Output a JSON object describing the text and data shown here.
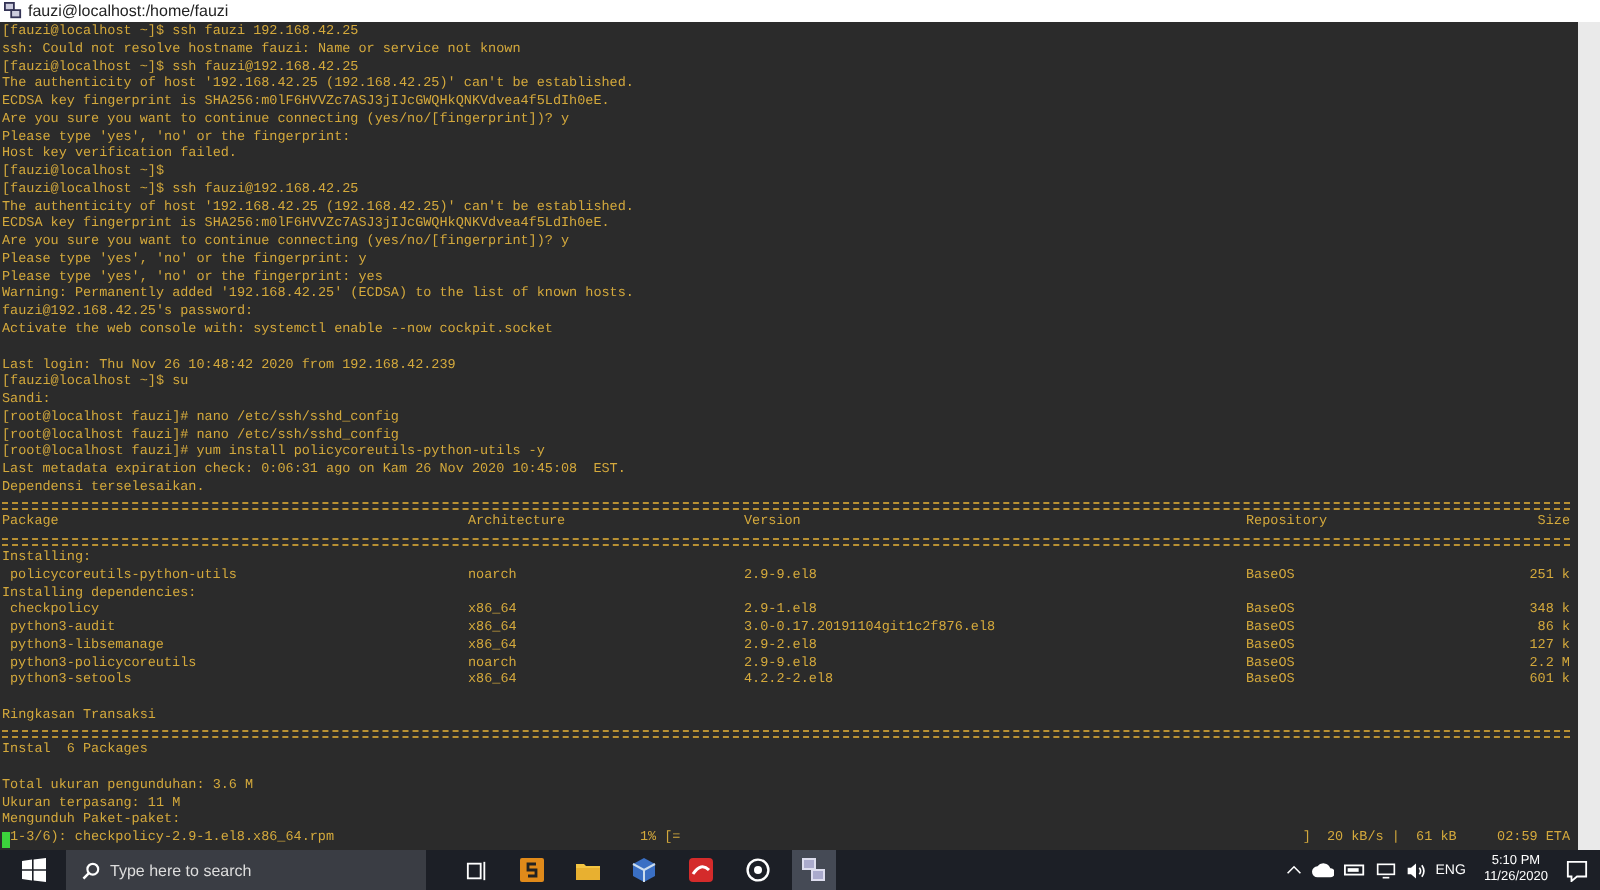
{
  "window": {
    "title": "fauzi@localhost:/home/fauzi"
  },
  "terminal": {
    "lines": [
      {
        "kind": "text",
        "text": "[fauzi@localhost ~]$ ssh fauzi 192.168.42.25"
      },
      {
        "kind": "text",
        "text": "ssh: Could not resolve hostname fauzi: Name or service not known"
      },
      {
        "kind": "text",
        "text": "[fauzi@localhost ~]$ ssh fauzi@192.168.42.25"
      },
      {
        "kind": "text",
        "text": "The authenticity of host '192.168.42.25 (192.168.42.25)' can't be established."
      },
      {
        "kind": "text",
        "text": "ECDSA key fingerprint is SHA256:m0lF6HVVZc7ASJ3jIJcGWQHkQNKVdvea4f5LdIh0eE."
      },
      {
        "kind": "text",
        "text": "Are you sure you want to continue connecting (yes/no/[fingerprint])? y"
      },
      {
        "kind": "text",
        "text": "Please type 'yes', 'no' or the fingerprint:"
      },
      {
        "kind": "text",
        "text": "Host key verification failed."
      },
      {
        "kind": "text",
        "text": "[fauzi@localhost ~]$"
      },
      {
        "kind": "text",
        "text": "[fauzi@localhost ~]$ ssh fauzi@192.168.42.25"
      },
      {
        "kind": "text",
        "text": "The authenticity of host '192.168.42.25 (192.168.42.25)' can't be established."
      },
      {
        "kind": "text",
        "text": "ECDSA key fingerprint is SHA256:m0lF6HVVZc7ASJ3jIJcGWQHkQNKVdvea4f5LdIh0eE."
      },
      {
        "kind": "text",
        "text": "Are you sure you want to continue connecting (yes/no/[fingerprint])? y"
      },
      {
        "kind": "text",
        "text": "Please type 'yes', 'no' or the fingerprint: y"
      },
      {
        "kind": "text",
        "text": "Please type 'yes', 'no' or the fingerprint: yes"
      },
      {
        "kind": "text",
        "text": "Warning: Permanently added '192.168.42.25' (ECDSA) to the list of known hosts."
      },
      {
        "kind": "text",
        "text": "fauzi@192.168.42.25's password:"
      },
      {
        "kind": "text",
        "text": "Activate the web console with: systemctl enable --now cockpit.socket"
      },
      {
        "kind": "blank"
      },
      {
        "kind": "text",
        "text": "Last login: Thu Nov 26 10:48:42 2020 from 192.168.42.239"
      },
      {
        "kind": "text",
        "text": "[fauzi@localhost ~]$ su"
      },
      {
        "kind": "text",
        "text": "Sandi:"
      },
      {
        "kind": "text",
        "text": "[root@localhost fauzi]# nano /etc/ssh/sshd_config"
      },
      {
        "kind": "text",
        "text": "[root@localhost fauzi]# nano /etc/ssh/sshd_config"
      },
      {
        "kind": "text",
        "text": "[root@localhost fauzi]# yum install policycoreutils-python-utils -y"
      },
      {
        "kind": "text",
        "text": "Last metadata expiration check: 0:06:31 ago on Kam 26 Nov 2020 10:45:08  EST."
      },
      {
        "kind": "text",
        "text": "Dependensi terselesaikan."
      },
      {
        "kind": "rule"
      },
      {
        "kind": "header",
        "cells": [
          "Package",
          "Architecture",
          "Version",
          "Repository",
          "Size"
        ]
      },
      {
        "kind": "rule"
      },
      {
        "kind": "text",
        "text": "Installing:"
      },
      {
        "kind": "row",
        "cells": [
          "policycoreutils-python-utils",
          "noarch",
          "2.9-9.el8",
          "BaseOS",
          "251 k"
        ]
      },
      {
        "kind": "text",
        "text": "Installing dependencies:"
      },
      {
        "kind": "row",
        "cells": [
          "checkpolicy",
          "x86_64",
          "2.9-1.el8",
          "BaseOS",
          "348 k"
        ]
      },
      {
        "kind": "row",
        "cells": [
          "python3-audit",
          "x86_64",
          "3.0-0.17.20191104git1c2f876.el8",
          "BaseOS",
          "86 k"
        ]
      },
      {
        "kind": "row",
        "cells": [
          "python3-libsemanage",
          "x86_64",
          "2.9-2.el8",
          "BaseOS",
          "127 k"
        ]
      },
      {
        "kind": "row",
        "cells": [
          "python3-policycoreutils",
          "noarch",
          "2.9-9.el8",
          "BaseOS",
          "2.2 M"
        ]
      },
      {
        "kind": "row",
        "cells": [
          "python3-setools",
          "x86_64",
          "4.2.2-2.el8",
          "BaseOS",
          "601 k"
        ]
      },
      {
        "kind": "blank"
      },
      {
        "kind": "text",
        "text": "Ringkasan Transaksi"
      },
      {
        "kind": "rule"
      },
      {
        "kind": "text",
        "text": "Instal  6 Packages"
      },
      {
        "kind": "blank"
      },
      {
        "kind": "text",
        "text": "Total ukuran pengunduhan: 3.6 M"
      },
      {
        "kind": "text",
        "text": "Ukuran terpasang: 11 M"
      },
      {
        "kind": "text",
        "text": "Mengunduh Paket-paket:"
      },
      {
        "kind": "progress",
        "text": "1-3/6): checkpolicy-2.9-1.el8.x86_64.rpm",
        "percent": "1%",
        "bar": "[=",
        "stats": "]  20 kB/s |  61 kB     02:59 ETA"
      }
    ]
  },
  "taskbar": {
    "search": {
      "placeholder": "Type here to search"
    },
    "language": "ENG",
    "time": "5:10 PM",
    "date": "11/26/2020"
  }
}
